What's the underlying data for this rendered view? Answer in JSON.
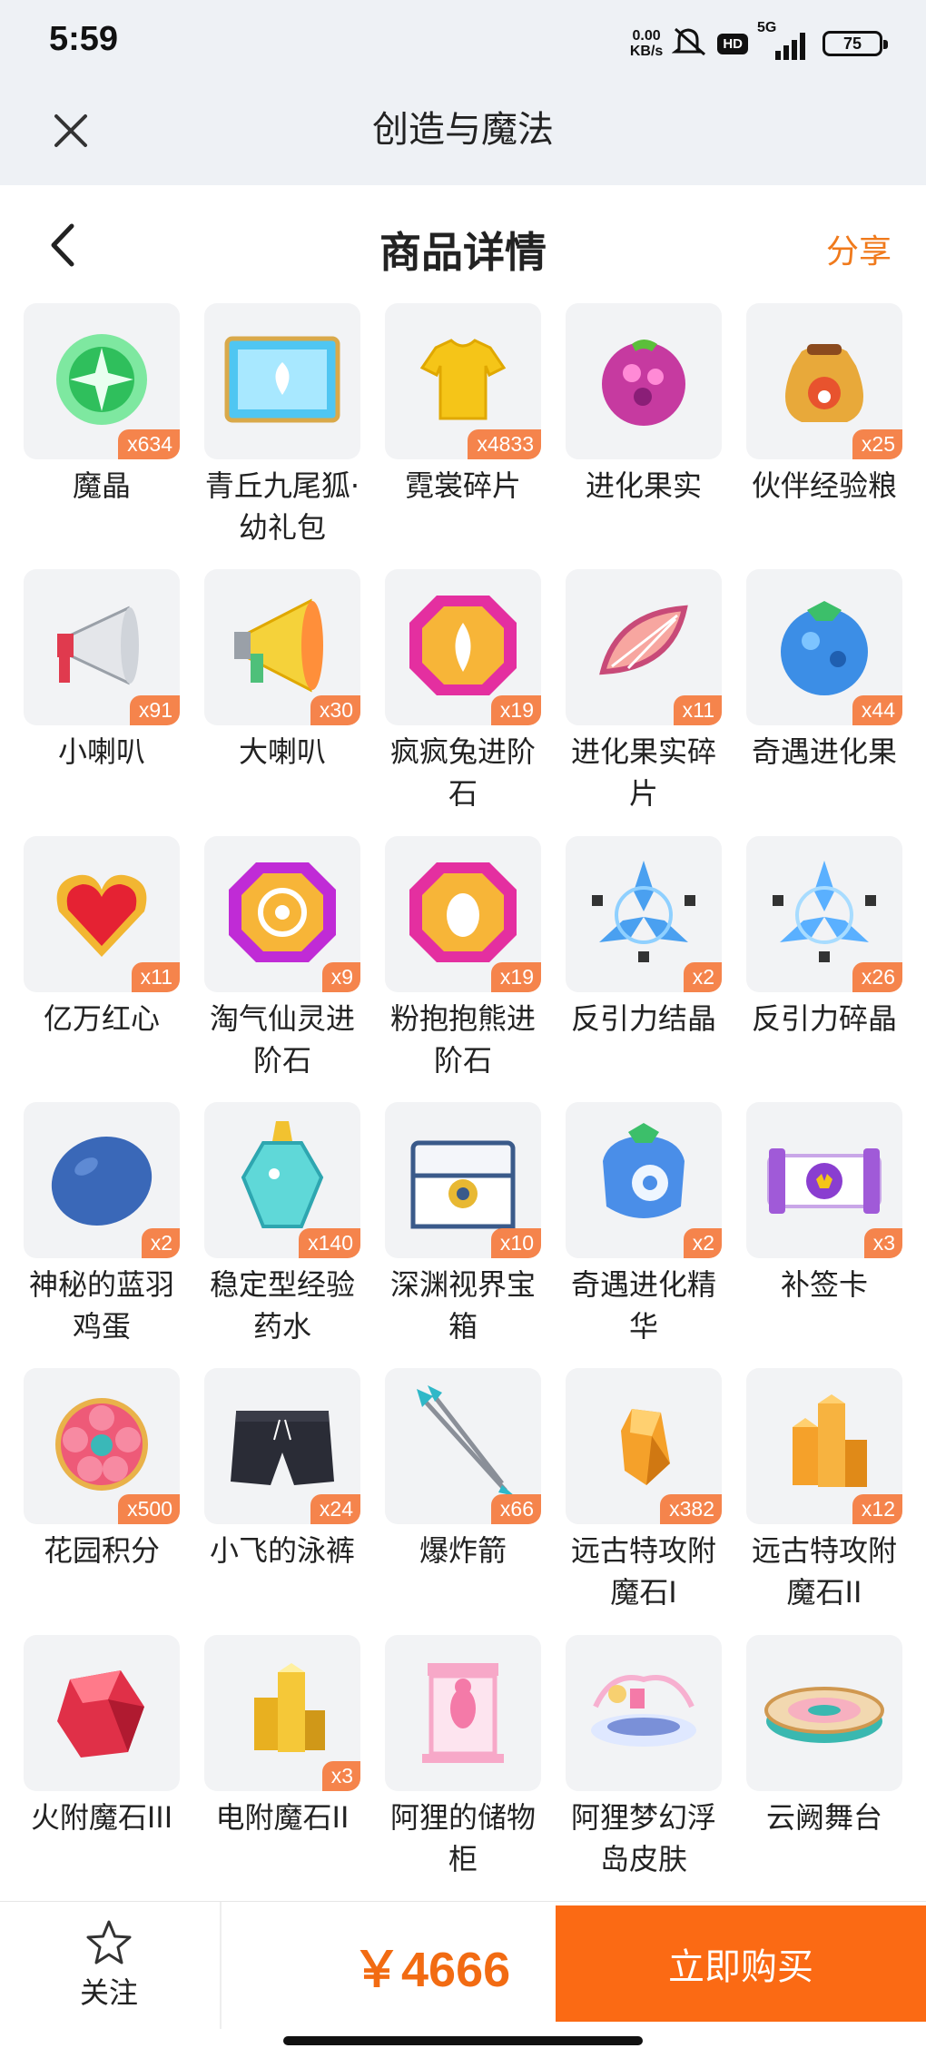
{
  "status_bar": {
    "time": "5:59",
    "net_speed_value": "0.00",
    "net_speed_unit": "KB/s",
    "hd_label": "HD",
    "signal_label": "5G",
    "battery_level": "75"
  },
  "app_bar": {
    "title": "创造与魔法"
  },
  "header": {
    "title": "商品详情",
    "share_label": "分享"
  },
  "items": [
    {
      "name": "魔晶",
      "qty": "x634"
    },
    {
      "name": "青丘九尾狐·幼礼包",
      "qty": ""
    },
    {
      "name": "霓裳碎片",
      "qty": "x4833"
    },
    {
      "name": "进化果实",
      "qty": ""
    },
    {
      "name": "伙伴经验粮",
      "qty": "x25"
    },
    {
      "name": "小喇叭",
      "qty": "x91"
    },
    {
      "name": "大喇叭",
      "qty": "x30"
    },
    {
      "name": "疯疯兔进阶石",
      "qty": "x19"
    },
    {
      "name": "进化果实碎片",
      "qty": "x11"
    },
    {
      "name": "奇遇进化果",
      "qty": "x44"
    },
    {
      "name": "亿万红心",
      "qty": "x11"
    },
    {
      "name": "淘气仙灵进阶石",
      "qty": "x9"
    },
    {
      "name": "粉抱抱熊进阶石",
      "qty": "x19"
    },
    {
      "name": "反引力结晶",
      "qty": "x2"
    },
    {
      "name": "反引力碎晶",
      "qty": "x26"
    },
    {
      "name": "神秘的蓝羽鸡蛋",
      "qty": "x2"
    },
    {
      "name": "稳定型经验药水",
      "qty": "x140"
    },
    {
      "name": "深渊视界宝箱",
      "qty": "x10"
    },
    {
      "name": "奇遇进化精华",
      "qty": "x2"
    },
    {
      "name": "补签卡",
      "qty": "x3"
    },
    {
      "name": "花园积分",
      "qty": "x500"
    },
    {
      "name": "小飞的泳裤",
      "qty": "x24"
    },
    {
      "name": "爆炸箭",
      "qty": "x66"
    },
    {
      "name": "远古特攻附魔石I",
      "qty": "x382"
    },
    {
      "name": "远古特攻附魔石II",
      "qty": "x12"
    },
    {
      "name": "火附魔石III",
      "qty": ""
    },
    {
      "name": "电附魔石II",
      "qty": "x3"
    },
    {
      "name": "阿狸的储物柜",
      "qty": ""
    },
    {
      "name": "阿狸梦幻浮岛皮肤",
      "qty": ""
    },
    {
      "name": "云阙舞台",
      "qty": ""
    }
  ],
  "item_icons": [
    "green-crystal-icon",
    "fox-gift-box-icon",
    "yellow-shirt-icon",
    "evolution-fruit-icon",
    "food-bag-icon",
    "small-megaphone-icon",
    "big-megaphone-icon",
    "rabbit-gem-icon",
    "fruit-slice-icon",
    "blue-fruit-icon",
    "red-heart-gem-icon",
    "fairy-gem-icon",
    "bear-gem-icon",
    "anti-gravity-crystal-icon",
    "anti-gravity-shard-icon",
    "blue-egg-icon",
    "potion-bottle-icon",
    "treasure-chest-icon",
    "evolution-essence-icon",
    "check-in-card-icon",
    "flower-badge-icon",
    "swim-shorts-icon",
    "arrows-icon",
    "orange-crystal-icon",
    "orange-crystal-cluster-icon",
    "red-crystal-icon",
    "gold-crystal-icon",
    "pink-cabinet-icon",
    "floating-island-icon",
    "stage-platform-icon"
  ],
  "bottom_bar": {
    "follow_label": "关注",
    "price": "￥4666",
    "buy_label": "立即购买"
  },
  "colors": {
    "accent": "#fb6a14",
    "price": "#f26b12",
    "share": "#f07a1c",
    "badge": "#f5844c",
    "app_bar_bg": "#eef1f5",
    "thumb_bg": "#f2f3f5"
  }
}
